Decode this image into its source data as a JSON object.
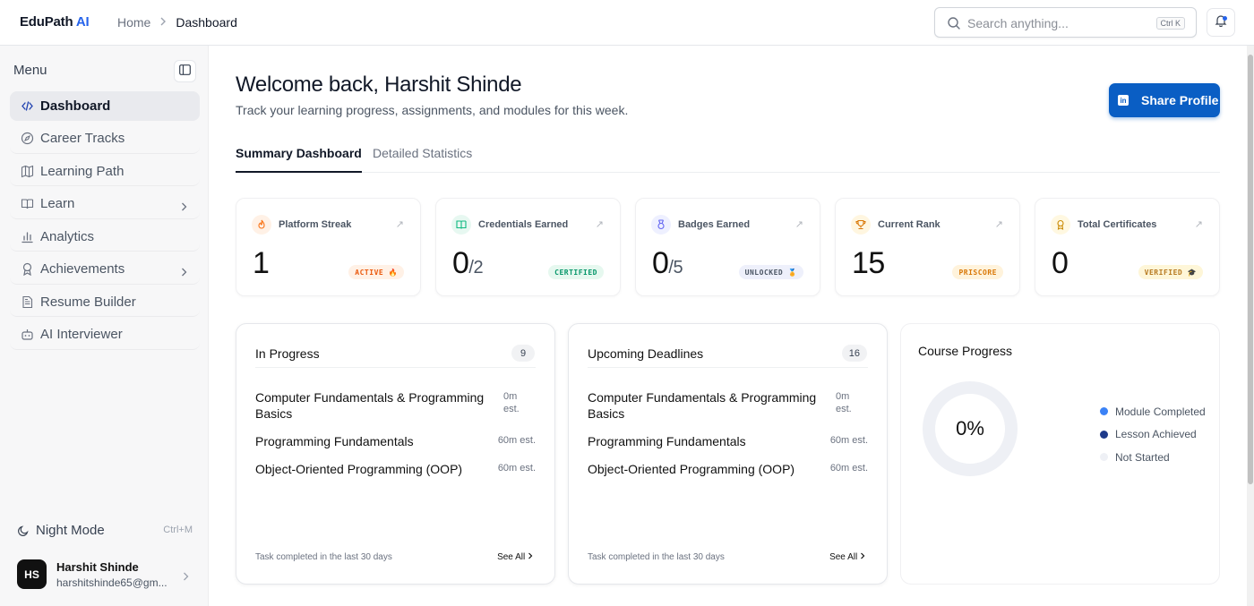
{
  "app": {
    "name_main": "EduPath",
    "name_accent": " AI"
  },
  "breadcrumb": {
    "home": "Home",
    "current": "Dashboard"
  },
  "search": {
    "placeholder": "Search anything...",
    "shortcut": "Ctrl K"
  },
  "sidebar": {
    "menu_title": "Menu",
    "items": [
      {
        "label": "Dashboard",
        "icon": "code-icon",
        "active": true
      },
      {
        "label": "Career Tracks",
        "icon": "compass-icon"
      },
      {
        "label": "Learning Path",
        "icon": "map-icon"
      },
      {
        "label": "Learn",
        "icon": "book-open-icon",
        "has_submenu": true
      },
      {
        "label": "Analytics",
        "icon": "bar-chart-icon"
      },
      {
        "label": "Achievements",
        "icon": "award-icon",
        "has_submenu": true
      },
      {
        "label": "Resume Builder",
        "icon": "file-text-icon"
      },
      {
        "label": "AI Interviewer",
        "icon": "bot-icon"
      }
    ],
    "night_mode": {
      "label": "Night Mode",
      "shortcut": "Ctrl+M"
    },
    "user": {
      "initials": "HS",
      "name": "Harshit Shinde",
      "email": "harshitshinde65@gm..."
    }
  },
  "header": {
    "welcome": "Welcome back, Harshit Shinde",
    "subtitle": "Track your learning progress, assignments, and modules for this week.",
    "share_label": "Share Profile"
  },
  "tabs": [
    {
      "label": "Summary Dashboard",
      "active": true
    },
    {
      "label": "Detailed Statistics"
    }
  ],
  "stats": [
    {
      "label": "Platform Streak",
      "value": "1",
      "total": "",
      "badge": "ACTIVE",
      "badge_emoji": "🔥",
      "icon": "flame-icon",
      "accent": "#f97316"
    },
    {
      "label": "Credentials Earned",
      "value": "0",
      "total": "/2",
      "badge": "CERTIFIED",
      "badge_emoji": "",
      "icon": "book-icon",
      "accent": "#10b981"
    },
    {
      "label": "Badges Earned",
      "value": "0",
      "total": "/5",
      "badge": "UNLOCKED",
      "badge_emoji": "🏅",
      "icon": "medal-icon",
      "accent": "#6366f1"
    },
    {
      "label": "Current Rank",
      "value": "15",
      "total": "",
      "badge": "PRISCORE",
      "badge_emoji": "",
      "icon": "trophy-icon",
      "accent": "#d97706"
    },
    {
      "label": "Total Certificates",
      "value": "0",
      "total": "",
      "badge": "VERIFIED",
      "badge_emoji": "🎓",
      "icon": "ribbon-icon",
      "accent": "#ca8a04"
    }
  ],
  "in_progress": {
    "title": "In Progress",
    "count": "9",
    "items": [
      {
        "title": "Computer Fundamentals & Programming Basics",
        "est": "0m est."
      },
      {
        "title": "Programming Fundamentals",
        "est": "60m est."
      },
      {
        "title": "Object-Oriented Programming (OOP)",
        "est": "60m est."
      }
    ],
    "footer": "Task completed in the last 30 days",
    "see_all": "See All"
  },
  "deadlines": {
    "title": "Upcoming Deadlines",
    "count": "16",
    "items": [
      {
        "title": "Computer Fundamentals & Programming Basics",
        "est": "0m est."
      },
      {
        "title": "Programming Fundamentals",
        "est": "60m est."
      },
      {
        "title": "Object-Oriented Programming (OOP)",
        "est": "60m est."
      }
    ],
    "footer": "Task completed in the last 30 days",
    "see_all": "See All"
  },
  "course_progress": {
    "title": "Course Progress",
    "percent_label": "0%",
    "percent": 0,
    "legend": [
      {
        "label": "Module Completed",
        "color": "#3b82f6"
      },
      {
        "label": "Lesson Achieved",
        "color": "#1e3a8a"
      },
      {
        "label": "Not Started",
        "color": "#eef0f5"
      }
    ]
  }
}
